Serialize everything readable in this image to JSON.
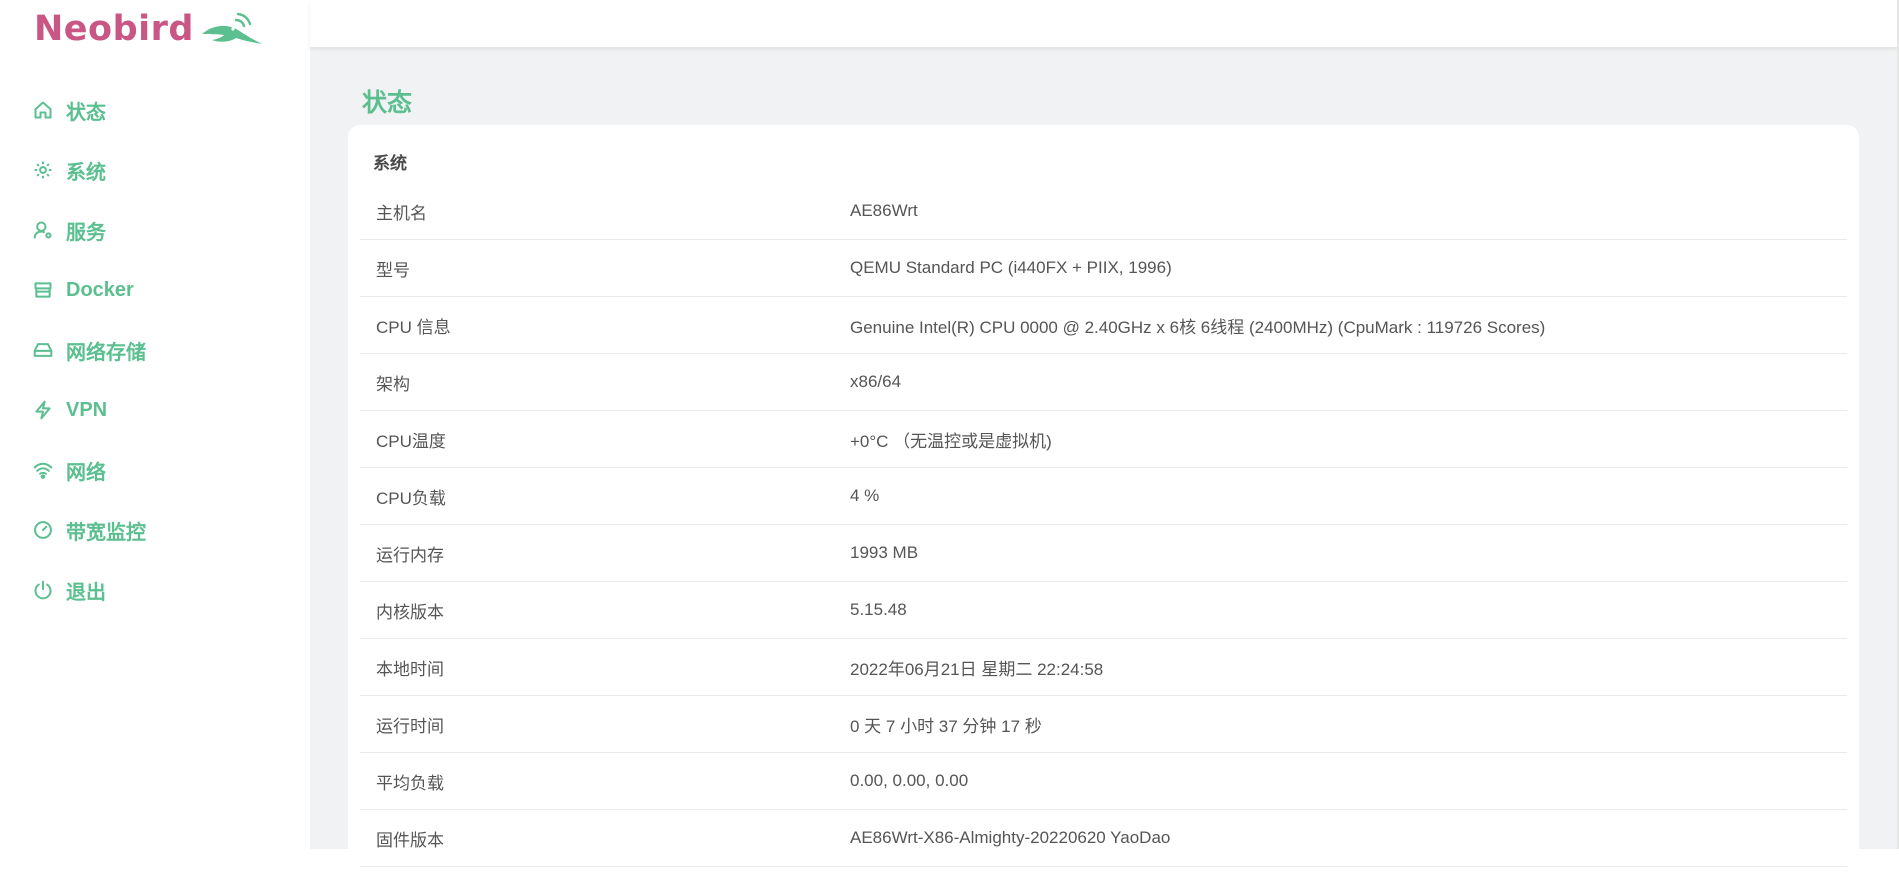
{
  "brand": {
    "name": "Neobird",
    "accent": "#5bbf90",
    "logo_color": "#c95685"
  },
  "sidebar": {
    "items": [
      {
        "label": "状态",
        "icon": "home-icon"
      },
      {
        "label": "系统",
        "icon": "gear-icon"
      },
      {
        "label": "服务",
        "icon": "user-gear-icon"
      },
      {
        "label": "Docker",
        "icon": "store-icon"
      },
      {
        "label": "网络存储",
        "icon": "drive-icon"
      },
      {
        "label": "VPN",
        "icon": "bolt-icon"
      },
      {
        "label": "网络",
        "icon": "wifi-icon"
      },
      {
        "label": "带宽监控",
        "icon": "gauge-icon"
      },
      {
        "label": "退出",
        "icon": "power-icon"
      }
    ]
  },
  "main": {
    "title": "状态",
    "section_title": "系统",
    "rows": [
      {
        "key": "主机名",
        "value": "AE86Wrt"
      },
      {
        "key": "型号",
        "value": "QEMU Standard PC (i440FX + PIIX, 1996)"
      },
      {
        "key": "CPU 信息",
        "value": "Genuine Intel(R) CPU 0000 @ 2.40GHz x 6核 6线程 (2400MHz) (CpuMark : 119726 Scores)"
      },
      {
        "key": "架构",
        "value": "x86/64"
      },
      {
        "key": "CPU温度",
        "value": "+0°C （无温控或是虚拟机)"
      },
      {
        "key": "CPU负载",
        "value": "4 %"
      },
      {
        "key": "运行内存",
        "value": "1993 MB"
      },
      {
        "key": "内核版本",
        "value": "5.15.48"
      },
      {
        "key": "本地时间",
        "value": "2022年06月21日 星期二 22:24:58"
      },
      {
        "key": "运行时间",
        "value": "0 天 7 小时 37 分钟 17 秒"
      },
      {
        "key": "平均负载",
        "value": "0.00, 0.00, 0.00"
      },
      {
        "key": "固件版本",
        "value": "AE86Wrt-X86-Almighty-20220620 YaoDao"
      }
    ]
  }
}
